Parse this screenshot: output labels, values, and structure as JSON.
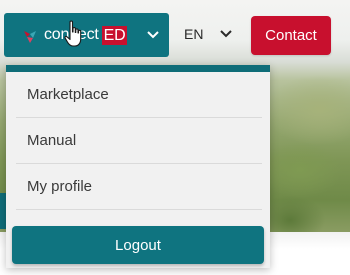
{
  "header": {
    "brand_text": "connect",
    "brand_suffix": "ED",
    "language": "EN",
    "contact_label": "Contact"
  },
  "dropdown": {
    "items": [
      {
        "label": "Marketplace"
      },
      {
        "label": "Manual"
      },
      {
        "label": "My profile"
      }
    ],
    "logout_label": "Logout"
  },
  "colors": {
    "teal": "#0f7480",
    "red": "#c8102e",
    "menu_bg": "#f1f1f1"
  },
  "icons": {
    "brand_chevron": "chevron-down-icon",
    "language_chevron": "chevron-down-icon",
    "cursor": "hand-pointer-icon",
    "logo": "connected-logo-icon"
  }
}
